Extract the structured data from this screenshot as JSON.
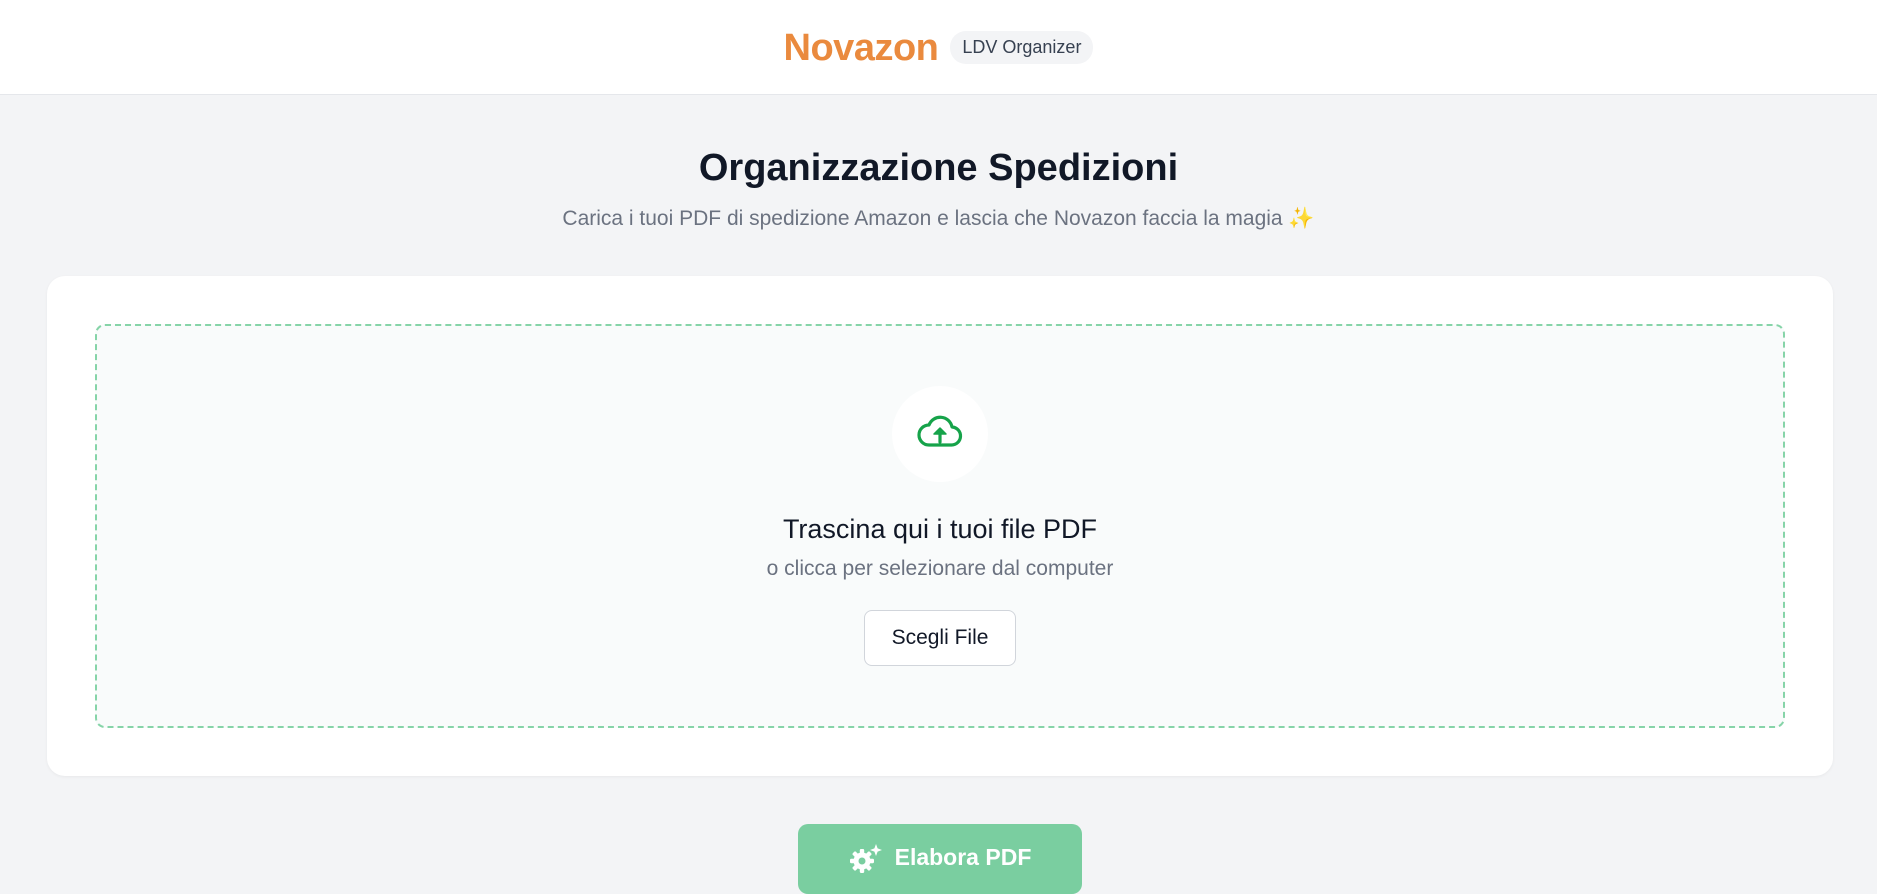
{
  "header": {
    "brand": "Novazon",
    "badge": "LDV Organizer"
  },
  "hero": {
    "title": "Organizzazione Spedizioni",
    "subtitle": "Carica i tuoi PDF di spedizione Amazon e lascia che Novazon faccia la magia ✨"
  },
  "dropzone": {
    "icon": "cloud-upload-icon",
    "title": "Trascina qui i tuoi file PDF",
    "subtitle": "o clicca per selezionare dal computer",
    "choose_label": "Scegli File"
  },
  "actions": {
    "process_label": "Elabora PDF",
    "process_icon": "gear-sparkle-icon"
  },
  "colors": {
    "brand": "#ea8a3e",
    "accent_green": "#16a34a",
    "dropzone_border": "#86d4a8",
    "process_button": "#7acea0"
  }
}
